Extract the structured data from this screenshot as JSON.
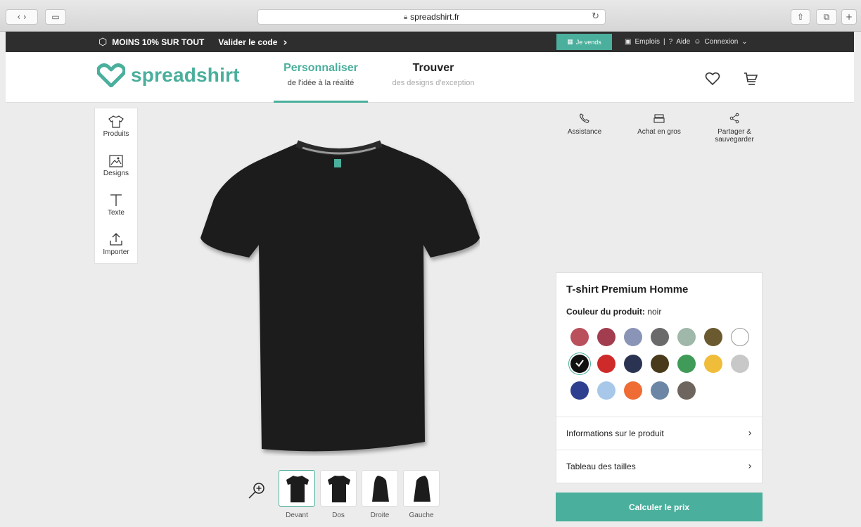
{
  "browser": {
    "url": "spreadshirt.fr",
    "lock_icon": "lock-icon",
    "reload_icon": "reload-icon"
  },
  "promo": {
    "text": "MOINS 10% SUR TOUT",
    "code_link": "Valider le code",
    "sell_button": "Je vends",
    "jobs": "Emplois",
    "separator": "|",
    "help": "Aide",
    "login": "Connexion"
  },
  "header": {
    "logo_text": "spreadshirt",
    "tabs": [
      {
        "label": "Personnaliser",
        "sub": "de l'idée à la réalité"
      },
      {
        "label": "Trouver",
        "sub": "des designs d'exception"
      }
    ]
  },
  "tools": [
    {
      "label": "Produits",
      "icon": "tshirt-icon"
    },
    {
      "label": "Designs",
      "icon": "image-icon"
    },
    {
      "label": "Texte",
      "icon": "text-icon"
    },
    {
      "label": "Importer",
      "icon": "upload-icon"
    }
  ],
  "actions": [
    {
      "label": "Assistance",
      "icon": "phone-icon"
    },
    {
      "label": "Achat en gros",
      "icon": "stack-icon"
    },
    {
      "label": "Partager & sauvegarder",
      "icon": "share-icon"
    }
  ],
  "views": [
    {
      "label": "Devant",
      "selected": true
    },
    {
      "label": "Dos",
      "selected": false
    },
    {
      "label": "Droite",
      "selected": false
    },
    {
      "label": "Gauche",
      "selected": false
    }
  ],
  "product": {
    "title": "T-shirt Premium Homme",
    "color_label": "Couleur du produit:",
    "color_value": "noir",
    "swatches": [
      "#b9505c",
      "#a23c4f",
      "#8a94b7",
      "#6a6a6a",
      "#9fb8a9",
      "#6b5a30",
      "#ffffff",
      "#111111",
      "#cf2a2a",
      "#2a3452",
      "#4a3a1c",
      "#3f9b57",
      "#f0bd3a",
      "#c8c8c8",
      "#2f3f8f",
      "#a7c8e8",
      "#ef6c34",
      "#6c87a5",
      "#6e665e"
    ],
    "selected_swatch": 7,
    "info_row": "Informations sur le produit",
    "size_row": "Tableau des tailles",
    "cta": "Calculer le prix"
  },
  "colors": {
    "accent": "#4aaf9c",
    "dark_bar": "#2e2e2e"
  }
}
